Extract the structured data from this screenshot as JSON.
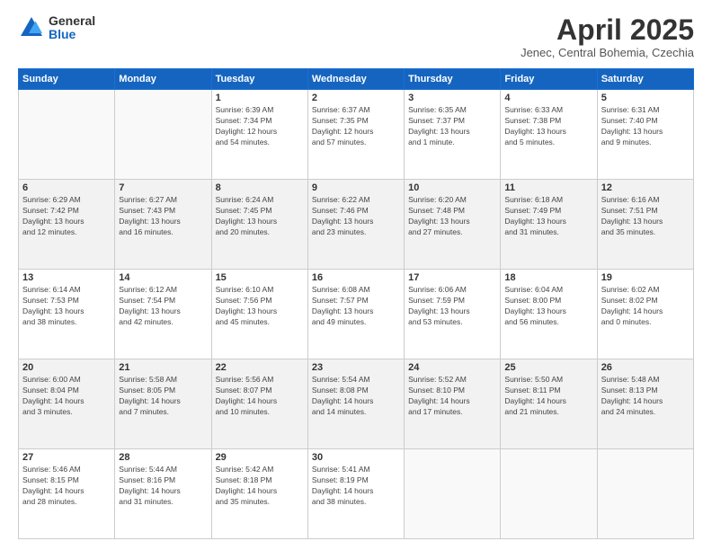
{
  "header": {
    "logo_general": "General",
    "logo_blue": "Blue",
    "month_title": "April 2025",
    "location": "Jenec, Central Bohemia, Czechia"
  },
  "days_of_week": [
    "Sunday",
    "Monday",
    "Tuesday",
    "Wednesday",
    "Thursday",
    "Friday",
    "Saturday"
  ],
  "weeks": [
    [
      {
        "day": "",
        "info": ""
      },
      {
        "day": "",
        "info": ""
      },
      {
        "day": "1",
        "info": "Sunrise: 6:39 AM\nSunset: 7:34 PM\nDaylight: 12 hours\nand 54 minutes."
      },
      {
        "day": "2",
        "info": "Sunrise: 6:37 AM\nSunset: 7:35 PM\nDaylight: 12 hours\nand 57 minutes."
      },
      {
        "day": "3",
        "info": "Sunrise: 6:35 AM\nSunset: 7:37 PM\nDaylight: 13 hours\nand 1 minute."
      },
      {
        "day": "4",
        "info": "Sunrise: 6:33 AM\nSunset: 7:38 PM\nDaylight: 13 hours\nand 5 minutes."
      },
      {
        "day": "5",
        "info": "Sunrise: 6:31 AM\nSunset: 7:40 PM\nDaylight: 13 hours\nand 9 minutes."
      }
    ],
    [
      {
        "day": "6",
        "info": "Sunrise: 6:29 AM\nSunset: 7:42 PM\nDaylight: 13 hours\nand 12 minutes."
      },
      {
        "day": "7",
        "info": "Sunrise: 6:27 AM\nSunset: 7:43 PM\nDaylight: 13 hours\nand 16 minutes."
      },
      {
        "day": "8",
        "info": "Sunrise: 6:24 AM\nSunset: 7:45 PM\nDaylight: 13 hours\nand 20 minutes."
      },
      {
        "day": "9",
        "info": "Sunrise: 6:22 AM\nSunset: 7:46 PM\nDaylight: 13 hours\nand 23 minutes."
      },
      {
        "day": "10",
        "info": "Sunrise: 6:20 AM\nSunset: 7:48 PM\nDaylight: 13 hours\nand 27 minutes."
      },
      {
        "day": "11",
        "info": "Sunrise: 6:18 AM\nSunset: 7:49 PM\nDaylight: 13 hours\nand 31 minutes."
      },
      {
        "day": "12",
        "info": "Sunrise: 6:16 AM\nSunset: 7:51 PM\nDaylight: 13 hours\nand 35 minutes."
      }
    ],
    [
      {
        "day": "13",
        "info": "Sunrise: 6:14 AM\nSunset: 7:53 PM\nDaylight: 13 hours\nand 38 minutes."
      },
      {
        "day": "14",
        "info": "Sunrise: 6:12 AM\nSunset: 7:54 PM\nDaylight: 13 hours\nand 42 minutes."
      },
      {
        "day": "15",
        "info": "Sunrise: 6:10 AM\nSunset: 7:56 PM\nDaylight: 13 hours\nand 45 minutes."
      },
      {
        "day": "16",
        "info": "Sunrise: 6:08 AM\nSunset: 7:57 PM\nDaylight: 13 hours\nand 49 minutes."
      },
      {
        "day": "17",
        "info": "Sunrise: 6:06 AM\nSunset: 7:59 PM\nDaylight: 13 hours\nand 53 minutes."
      },
      {
        "day": "18",
        "info": "Sunrise: 6:04 AM\nSunset: 8:00 PM\nDaylight: 13 hours\nand 56 minutes."
      },
      {
        "day": "19",
        "info": "Sunrise: 6:02 AM\nSunset: 8:02 PM\nDaylight: 14 hours\nand 0 minutes."
      }
    ],
    [
      {
        "day": "20",
        "info": "Sunrise: 6:00 AM\nSunset: 8:04 PM\nDaylight: 14 hours\nand 3 minutes."
      },
      {
        "day": "21",
        "info": "Sunrise: 5:58 AM\nSunset: 8:05 PM\nDaylight: 14 hours\nand 7 minutes."
      },
      {
        "day": "22",
        "info": "Sunrise: 5:56 AM\nSunset: 8:07 PM\nDaylight: 14 hours\nand 10 minutes."
      },
      {
        "day": "23",
        "info": "Sunrise: 5:54 AM\nSunset: 8:08 PM\nDaylight: 14 hours\nand 14 minutes."
      },
      {
        "day": "24",
        "info": "Sunrise: 5:52 AM\nSunset: 8:10 PM\nDaylight: 14 hours\nand 17 minutes."
      },
      {
        "day": "25",
        "info": "Sunrise: 5:50 AM\nSunset: 8:11 PM\nDaylight: 14 hours\nand 21 minutes."
      },
      {
        "day": "26",
        "info": "Sunrise: 5:48 AM\nSunset: 8:13 PM\nDaylight: 14 hours\nand 24 minutes."
      }
    ],
    [
      {
        "day": "27",
        "info": "Sunrise: 5:46 AM\nSunset: 8:15 PM\nDaylight: 14 hours\nand 28 minutes."
      },
      {
        "day": "28",
        "info": "Sunrise: 5:44 AM\nSunset: 8:16 PM\nDaylight: 14 hours\nand 31 minutes."
      },
      {
        "day": "29",
        "info": "Sunrise: 5:42 AM\nSunset: 8:18 PM\nDaylight: 14 hours\nand 35 minutes."
      },
      {
        "day": "30",
        "info": "Sunrise: 5:41 AM\nSunset: 8:19 PM\nDaylight: 14 hours\nand 38 minutes."
      },
      {
        "day": "",
        "info": ""
      },
      {
        "day": "",
        "info": ""
      },
      {
        "day": "",
        "info": ""
      }
    ]
  ]
}
